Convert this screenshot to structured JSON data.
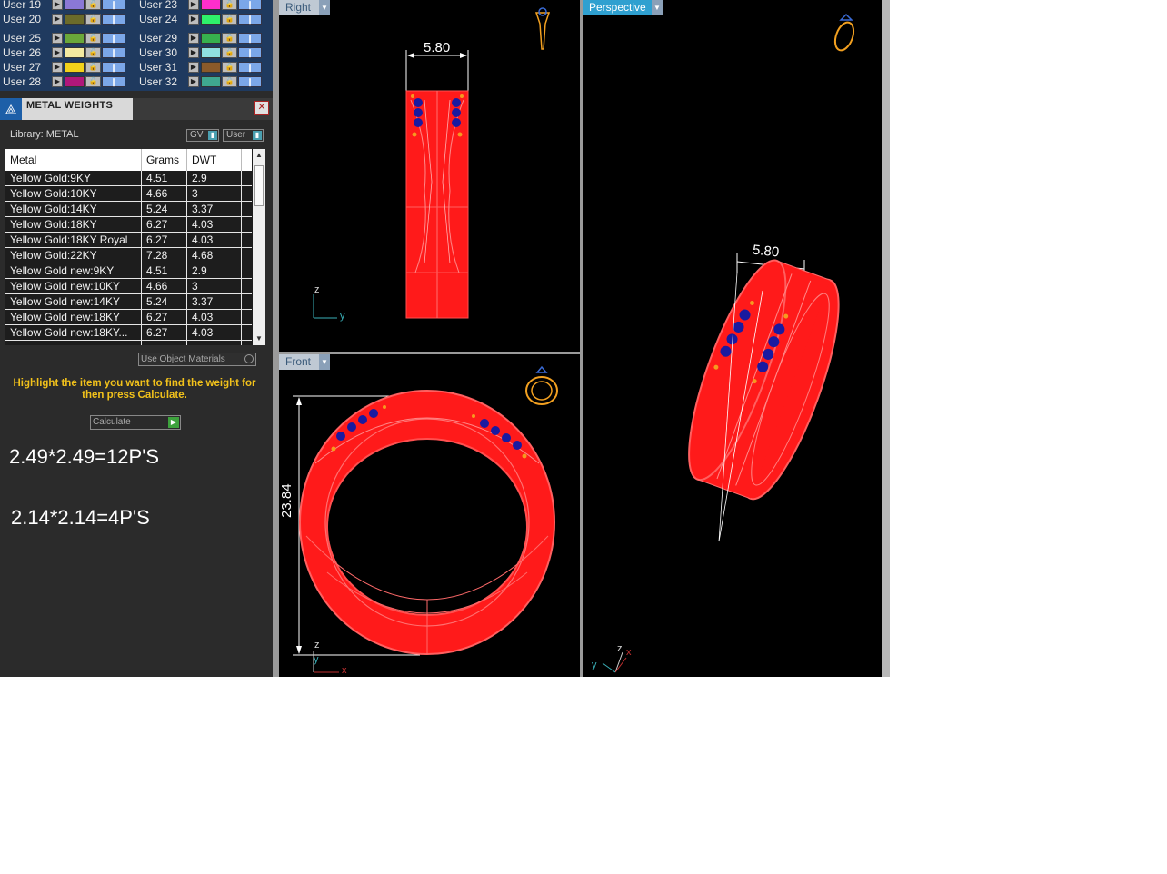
{
  "layers": [
    {
      "name": "User 19",
      "color": "#8b78d6"
    },
    {
      "name": "User 20",
      "color": "#6b6b2a"
    },
    {
      "name": "User 25",
      "color": "#6aa83a"
    },
    {
      "name": "User 26",
      "color": "#f3e9a0"
    },
    {
      "name": "User 27",
      "color": "#f2d21a"
    },
    {
      "name": "User 28",
      "color": "#b0177a"
    },
    {
      "name": "User 23",
      "color": "#ff2ecb"
    },
    {
      "name": "User 24",
      "color": "#2ef06b"
    },
    {
      "name": "User 29",
      "color": "#37b14e"
    },
    {
      "name": "User 30",
      "color": "#8fe0e0"
    },
    {
      "name": "User 31",
      "color": "#8a5a2a"
    },
    {
      "name": "User 32",
      "color": "#3fa890"
    }
  ],
  "metal_weights": {
    "title": "METAL WEIGHTS",
    "library_label": "Library: METAL",
    "gv_label": "GV",
    "user_label": "User",
    "columns": [
      "Metal",
      "Grams",
      "DWT"
    ],
    "rows": [
      [
        "Yellow Gold:9KY",
        "4.51",
        "2.9"
      ],
      [
        "Yellow Gold:10KY",
        "4.66",
        "3"
      ],
      [
        "Yellow Gold:14KY",
        "5.24",
        "3.37"
      ],
      [
        "Yellow Gold:18KY",
        "6.27",
        "4.03"
      ],
      [
        "Yellow Gold:18KY Royal",
        "6.27",
        "4.03"
      ],
      [
        "Yellow Gold:22KY",
        "7.28",
        "4.68"
      ],
      [
        "Yellow Gold new:9KY",
        "4.51",
        "2.9"
      ],
      [
        "Yellow Gold new:10KY",
        "4.66",
        "3"
      ],
      [
        "Yellow Gold new:14KY",
        "5.24",
        "3.37"
      ],
      [
        "Yellow Gold new:18KY",
        "6.27",
        "4.03"
      ],
      [
        "Yellow Gold new:18KY...",
        "6.27",
        "4.03"
      ]
    ],
    "use_object_materials": "Use Object Materials",
    "hint": "Highlight the item you want to find the weight for then press Calculate.",
    "calculate_label": "Calculate"
  },
  "notes": [
    "2.49*2.49=12P'S",
    "2.14*2.14=4P'S"
  ],
  "viewports": {
    "right": {
      "label": "Right",
      "dimension": "5.80",
      "axis_v": "z",
      "axis_h": "y"
    },
    "front": {
      "label": "Front",
      "dimension": "23.84",
      "axis_v": "z",
      "axis_h": "x",
      "axis_d": "y"
    },
    "perspective": {
      "label": "Perspective",
      "dimension": "5.80",
      "axis_z": "z",
      "axis_x": "x",
      "axis_y": "y"
    }
  },
  "colors": {
    "model": "#ff1a1a",
    "gem": "#1a1aa0",
    "accent_gem": "#f59a20",
    "panel_bg": "#2b2b2b"
  }
}
